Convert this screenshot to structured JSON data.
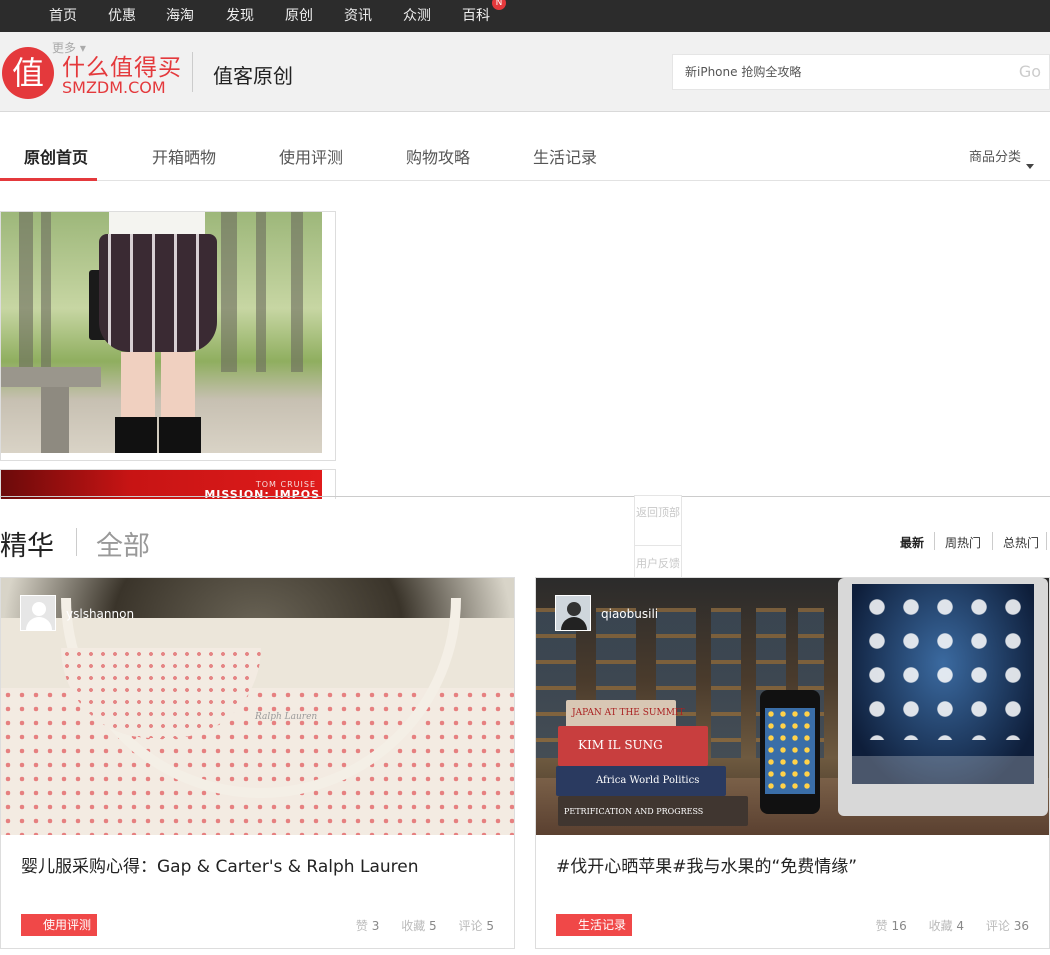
{
  "topnav": {
    "items": [
      "首页",
      "优惠",
      "海淘",
      "发现",
      "原创",
      "资讯",
      "众测",
      "百科"
    ],
    "badge": "N"
  },
  "header": {
    "more": "更多",
    "logo_char": "值",
    "logo_cn": "什么值得买",
    "logo_en": "SMZDM.COM",
    "title": "值客原创",
    "search_placeholder": "新iPhone 抢购全攻略",
    "search_go": "Go"
  },
  "subnav": {
    "tabs": [
      "原创首页",
      "开箱晒物",
      "使用评测",
      "购物攻略",
      "生活记录"
    ],
    "active_index": 0,
    "category": "商品分类"
  },
  "hero": {
    "banner2_line1": "TOM CRUISE",
    "banner2_line2": "MISSION: IMPOS"
  },
  "floating": {
    "back_to_top": "返回顶部",
    "feedback": "用户反馈"
  },
  "section": {
    "title": "精华",
    "all": "全部",
    "sorts": [
      "最新",
      "周热门",
      "总热门"
    ],
    "active_sort": "最新"
  },
  "cards": [
    {
      "username": "yslshannon",
      "title": "婴儿服采购心得：Gap & Carter's & Ralph Lauren",
      "tag": "使用评测",
      "photo_label": "Ralph Lauren",
      "stats": {
        "like_label": "赞",
        "like": "3",
        "fav_label": "收藏",
        "fav": "5",
        "comment_label": "评论",
        "comment": "5"
      }
    },
    {
      "username": "qiaobusili",
      "title": "#伐开心晒苹果#我与水果的“免费情缘”",
      "tag": "生活记录",
      "photo_books": [
        "JAPAN AT THE SUMMIT",
        "KIM IL SUNG",
        "Africa World Politics",
        "PETRIFICATION AND PROGRESS"
      ],
      "stats": {
        "like_label": "赞",
        "like": "16",
        "fav_label": "收藏",
        "fav": "4",
        "comment_label": "评论",
        "comment": "36"
      }
    }
  ],
  "colors": {
    "brand_red": "#e4393c",
    "tag_red": "#f04848",
    "topnav_bg": "#2c2c2c"
  }
}
